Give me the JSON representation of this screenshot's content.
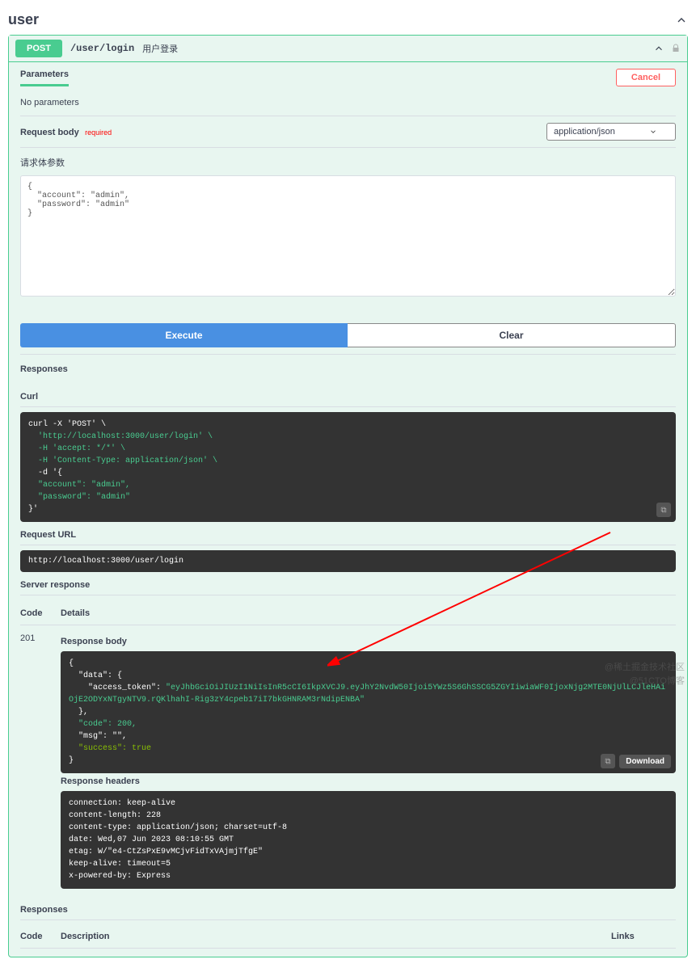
{
  "section_title": "user",
  "operation": {
    "method": "POST",
    "path": "/user/login",
    "summary": "用户登录"
  },
  "tabs": {
    "parameters": "Parameters"
  },
  "cancel": "Cancel",
  "no_params": "No parameters",
  "request_body": {
    "title": "Request body",
    "required": "required",
    "content_type": "application/json",
    "description": "请求体参数",
    "value": "{\n  \"account\": \"admin\",\n  \"password\": \"admin\"\n}"
  },
  "buttons": {
    "execute": "Execute",
    "clear": "Clear"
  },
  "responses_label": "Responses",
  "curl": {
    "label": "Curl",
    "cmd": "curl -X 'POST' \\",
    "url": "  'http://localhost:3000/user/login' \\",
    "h1": "  -H 'accept: */*' \\",
    "h2": "  -H 'Content-Type: application/json' \\",
    "d": "  -d '{",
    "b1": "  \"account\": \"admin\",",
    "b2": "  \"password\": \"admin\"",
    "end": "}'"
  },
  "request_url": {
    "label": "Request URL",
    "value": "http://localhost:3000/user/login"
  },
  "server_response": {
    "label": "Server response",
    "code_header": "Code",
    "details_header": "Details",
    "code": "201",
    "body_label": "Response body",
    "body_json": {
      "open": "{",
      "data_open": "  \"data\": {",
      "token_key": "    \"access_token\": ",
      "token_val": "\"eyJhbGciOiJIUzI1NiIsInR5cCI6IkpXVCJ9.eyJhY2NvdW50Ijoi5YWz5S6GhSSCG5ZGYIiwiaWF0IjoxNjg2MTE0NjUlLCJleHAiOjE2ODYxNTgyNTV9.rQKlhahI-Rig3zY4cpeb17iI7bkGHNRAM3rNdipENBA\"",
      "data_close": "  },",
      "code_line": "  \"code\": 200,",
      "msg_line": "  \"msg\": \"\",",
      "success_line": "  \"success\": true",
      "close": "}"
    },
    "download": "Download",
    "headers_label": "Response headers",
    "headers": "connection: keep-alive\ncontent-length: 228\ncontent-type: application/json; charset=utf-8\ndate: Wed,07 Jun 2023 08:10:55 GMT\netag: W/\"e4-CtZsPxE9vMCjvFidTxVAjmjTfgE\"\nkeep-alive: timeout=5\nx-powered-by: Express"
  },
  "responses2": {
    "label": "Responses",
    "code_h": "Code",
    "desc_h": "Description",
    "links_h": "Links"
  },
  "watermark": {
    "line1": "@稀土掘金技术社区",
    "line2": "@51CTO博客"
  }
}
